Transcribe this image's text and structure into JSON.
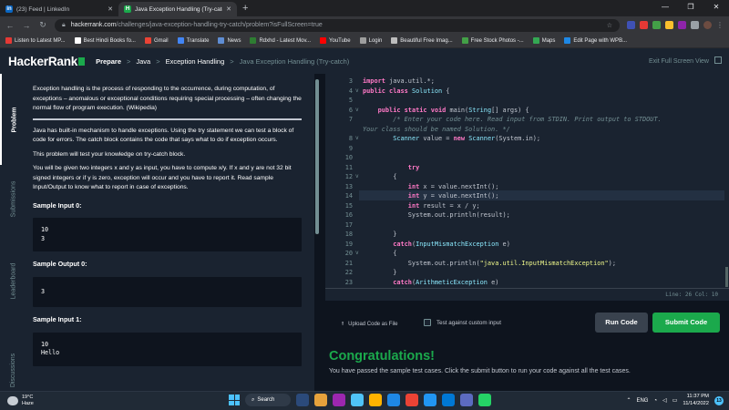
{
  "browser": {
    "tabs": [
      {
        "title": "(23) Feed | LinkedIn",
        "icon": "linkedin-icon",
        "color": "#0a66c2",
        "glyph": "in"
      },
      {
        "title": "Java Exception Handling (Try-catc",
        "icon": "hackerrank-icon",
        "color": "#1ba94c",
        "glyph": "H"
      }
    ],
    "new_tab": "+",
    "window_controls": [
      "—",
      "❐",
      "✕"
    ],
    "url_host": "hackerrank.com",
    "url_path": "/challenges/java-exception-handling-try-catch/problem?isFullScreen=true",
    "bookmarks": [
      {
        "label": "Listen to Latest MP...",
        "color": "#e53935"
      },
      {
        "label": "Best Hindi Books fo...",
        "color": "#ffffff"
      },
      {
        "label": "Gmail",
        "color": "#ea4335"
      },
      {
        "label": "Translate",
        "color": "#4285f4"
      },
      {
        "label": "News",
        "color": "#5f8dd3"
      },
      {
        "label": "Rdxhd - Latest Mov...",
        "color": "#2e7d32"
      },
      {
        "label": "YouTube",
        "color": "#ff0000"
      },
      {
        "label": "Login",
        "color": "#9e9e9e"
      },
      {
        "label": "Beautiful Free Imag...",
        "color": "#bdbdbd"
      },
      {
        "label": "Free Stock Photos -...",
        "color": "#43a047"
      },
      {
        "label": "Maps",
        "color": "#34a853"
      },
      {
        "label": "Edit Page with WPB...",
        "color": "#1e88e5"
      }
    ]
  },
  "header": {
    "logo": "HackerRank",
    "breadcrumbs": [
      "Prepare",
      "Java",
      "Exception Handling",
      "Java Exception Handling (Try-catch)"
    ],
    "breadcrumb_sep": ">",
    "exit_fullscreen": "Exit Full Screen View"
  },
  "vertical_tabs": [
    "Problem",
    "Submissions",
    "Leaderboard",
    "Discussions"
  ],
  "problem": {
    "intro": "Exception handling is the process of responding to the occurrence, during computation, of exceptions – anomalous or exceptional conditions requiring special processing – often changing the normal flow of program execution. (Wikipedia)",
    "para1": "Java has built-in mechanism to handle exceptions. Using the try statement we can test a block of code for errors. The catch block contains the code that says what to do if exception occurs.",
    "para2": "This problem will test your knowledge on try-catch block.",
    "para3": "You will be given two integers x and y as input, you have to compute x/y. If x and y are not 32 bit signed integers or if y is zero, exception will occur and you have to report it. Read sample Input/Output to know what to report in case of exceptions.",
    "sample_input_0_title": "Sample Input 0:",
    "sample_input_0": [
      "10",
      "3"
    ],
    "sample_output_0_title": "Sample Output 0:",
    "sample_output_0": [
      "3"
    ],
    "sample_input_1_title": "Sample Input 1:",
    "sample_input_1": [
      "10",
      "Hello"
    ]
  },
  "editor": {
    "lines": [
      {
        "n": "3",
        "fold": "",
        "html": "<span class='kw'>import</span> java.util.*;"
      },
      {
        "n": "4",
        "fold": "v",
        "html": "<span class='kw'>public class</span> <span class='cls'>Solution</span> {"
      },
      {
        "n": "5",
        "fold": "",
        "html": ""
      },
      {
        "n": "6",
        "fold": "v",
        "html": "    <span class='kw'>public static void</span> main(<span class='cls'>String</span>[] args) {"
      },
      {
        "n": "7",
        "fold": "",
        "html": "        <span class='cmt'>/* Enter your code here. Read input from STDIN. Print output to STDOUT.</span>"
      },
      {
        "n": "",
        "fold": "",
        "html": "<span class='cmt'>Your class should be named Solution. */</span>",
        "indent": 0
      },
      {
        "n": "8",
        "fold": "v",
        "html": "        <span class='cls'>Scanner</span> value = <span class='kw'>new</span> <span class='cls'>Scanner</span>(System.in);"
      },
      {
        "n": "9",
        "fold": "",
        "html": ""
      },
      {
        "n": "10",
        "fold": "",
        "html": ""
      },
      {
        "n": "11",
        "fold": "",
        "html": "            <span class='kw'>try</span>"
      },
      {
        "n": "12",
        "fold": "v",
        "html": "        {"
      },
      {
        "n": "13",
        "fold": "",
        "html": "            <span class='kw'>int</span> x = value.nextInt();"
      },
      {
        "n": "14",
        "fold": "",
        "html": "            <span class='kw'>int</span> y = value.nextInt();"
      },
      {
        "n": "15",
        "fold": "",
        "html": "            <span class='kw'>int</span> result = x / y;"
      },
      {
        "n": "16",
        "fold": "",
        "html": "            System.out.println(result);"
      },
      {
        "n": "17",
        "fold": "",
        "html": ""
      },
      {
        "n": "18",
        "fold": "",
        "html": "        }"
      },
      {
        "n": "19",
        "fold": "",
        "html": "        <span class='kw'>catch</span>(<span class='cls'>InputMismatchException</span> e)"
      },
      {
        "n": "20",
        "fold": "v",
        "html": "        {"
      },
      {
        "n": "21",
        "fold": "",
        "html": "            System.out.println(<span class='str'>\"java.util.InputMismatchException\"</span>);"
      },
      {
        "n": "22",
        "fold": "",
        "html": "        }"
      },
      {
        "n": "23",
        "fold": "",
        "html": "        <span class='kw'>catch</span>(<span class='cls'>ArithmeticException</span> e)"
      }
    ],
    "status": "Line: 26 Col: 10"
  },
  "actions": {
    "upload": "Upload Code as File",
    "custom_input": "Test against custom input",
    "run": "Run Code",
    "submit": "Submit Code"
  },
  "result": {
    "title": "Congratulations!",
    "message": "You have passed the sample test cases. Click the submit button to run your code against all the test cases."
  },
  "taskbar": {
    "temp": "19°C",
    "weather": "Haze",
    "search": "Search",
    "lang": "ENG",
    "time": "11:37 PM",
    "date": "11/14/2022",
    "notif_count": "13",
    "app_colors": [
      "#2b4a7a",
      "#e6a23c",
      "#9c27b0",
      "#4fc3f7",
      "#ffb300",
      "#1e88e5",
      "#ea4335",
      "#2196f3",
      "#0078d4",
      "#5c6bc0",
      "#25d366"
    ]
  },
  "colors": {
    "accent": "#1ba94c",
    "background": "#0e141e",
    "panel": "#1a2330"
  }
}
